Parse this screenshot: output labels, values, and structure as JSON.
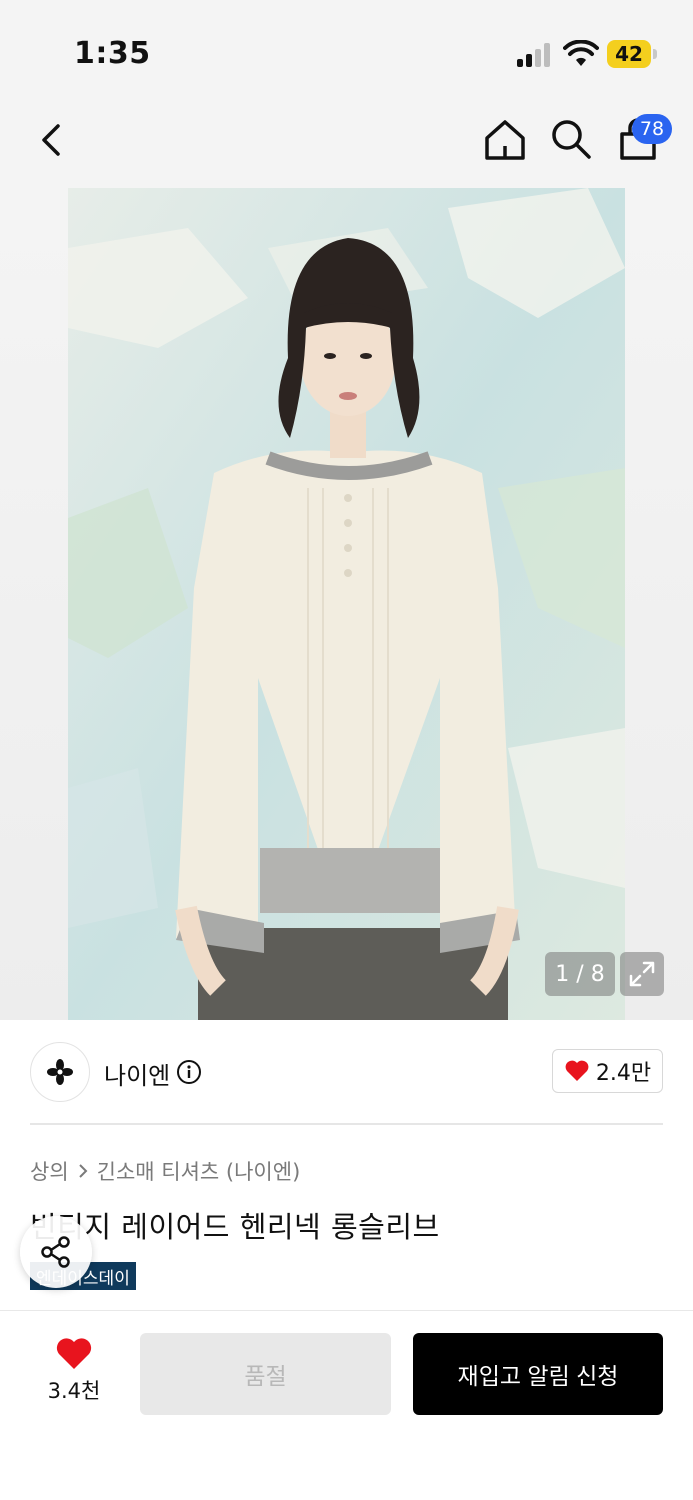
{
  "status_bar": {
    "time": "1:35",
    "battery": "42"
  },
  "nav": {
    "cart_count": "78"
  },
  "gallery": {
    "page_indicator": "1 / 8"
  },
  "brand": {
    "name": "나이엔",
    "like_count": "2.4만"
  },
  "product": {
    "breadcrumb": [
      "상의",
      "긴소매 티셔츠 (나이엔)"
    ],
    "title": "빈티지 레이어드 헨리넥 롱슬리브",
    "tag": "엔데이스데이"
  },
  "bottom": {
    "wish_count": "3.4천",
    "soldout_label": "품절",
    "restock_label": "재입고 알림 신청"
  },
  "colors": {
    "accent": "#2a64f0",
    "heart": "#e8141e",
    "tag_bg": "#0f3a5c",
    "primary_button": "#000000"
  },
  "icons": [
    "back-icon",
    "home-icon",
    "search-icon",
    "shopping-bag-icon",
    "expand-icon",
    "info-icon",
    "heart-icon",
    "share-icon"
  ]
}
